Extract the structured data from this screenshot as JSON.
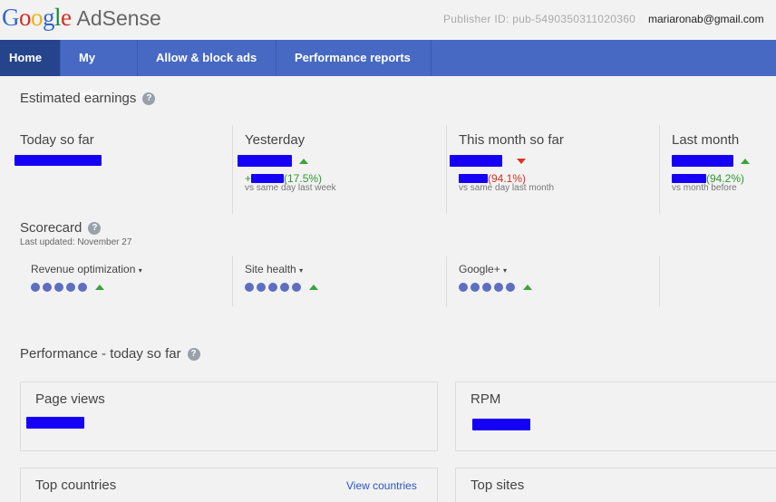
{
  "header": {
    "logo_letters": [
      "G",
      "o",
      "o",
      "g",
      "l",
      "e"
    ],
    "product": "AdSense",
    "publisher_id": "Publisher ID: pub-5490350311020360",
    "user_email": "mariaronab@gmail.com"
  },
  "nav": {
    "tabs": [
      {
        "label": "Home",
        "active": true
      },
      {
        "label": "My ads",
        "active": false
      },
      {
        "label": "Allow & block ads",
        "active": false
      },
      {
        "label": "Performance reports",
        "active": false
      }
    ]
  },
  "earnings": {
    "title": "Estimated earnings",
    "columns": [
      {
        "label": "Today so far",
        "trend": null,
        "change_text": "",
        "compare": ""
      },
      {
        "label": "Yesterday",
        "trend": "up",
        "change_text": "(17.5%)",
        "compare": "vs same day last week"
      },
      {
        "label": "This month so far",
        "trend": "down",
        "change_text": "(94.1%)",
        "compare": "vs same day last month"
      },
      {
        "label": "Last month",
        "trend": "up",
        "change_text": "(94.2%)",
        "compare": "vs month before"
      }
    ]
  },
  "scorecard": {
    "title": "Scorecard",
    "last_updated": "Last updated: November 27",
    "items": [
      {
        "label": "Revenue optimization",
        "dots": 5,
        "trend": "up"
      },
      {
        "label": "Site health",
        "dots": 5,
        "trend": "up"
      },
      {
        "label": "Google+",
        "dots": 5,
        "trend": "up"
      }
    ]
  },
  "performance": {
    "title": "Performance - today so far",
    "cards": {
      "page_views": "Page views",
      "rpm": "RPM",
      "top_countries": "Top countries",
      "view_countries": "View countries",
      "top_sites": "Top sites"
    }
  },
  "colors": {
    "nav_bg": "#4769c4",
    "nav_active": "#26448c",
    "redaction": "#1500f5",
    "positive": "#2e9a2e",
    "negative": "#cc3322"
  }
}
